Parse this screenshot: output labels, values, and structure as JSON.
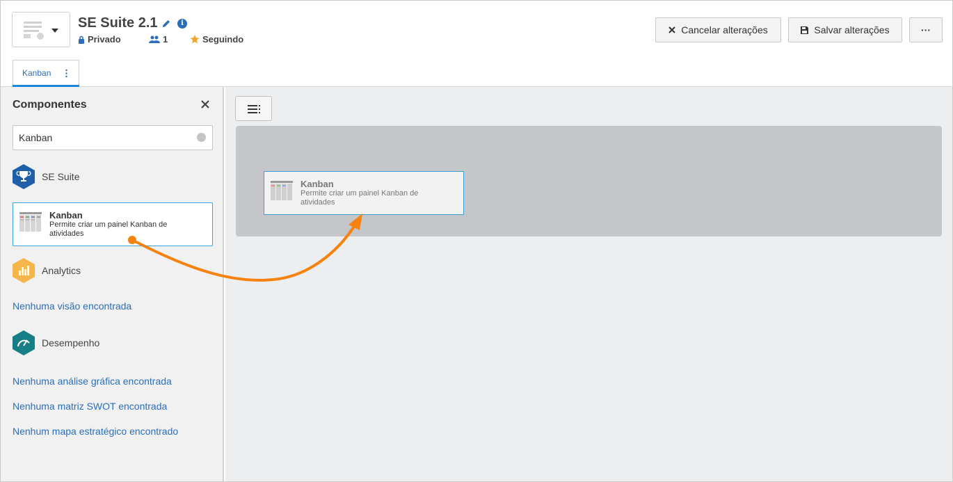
{
  "header": {
    "title": "SE Suite 2.1",
    "privacy": "Privado",
    "members": "1",
    "following": "Seguindo",
    "cancel_label": "Cancelar alterações",
    "save_label": "Salvar alterações",
    "more_label": "···"
  },
  "tabs": [
    {
      "label": "Kanban"
    }
  ],
  "sidebar": {
    "title": "Componentes",
    "search": {
      "value": "Kanban"
    },
    "groups": [
      {
        "label": "SE Suite",
        "icon": "trophy-icon",
        "color": "#1e5fa8"
      },
      {
        "label": "Analytics",
        "icon": "bar-chart-icon",
        "color": "#f5b54a"
      },
      {
        "label": "Desempenho",
        "icon": "gauge-icon",
        "color": "#167e86"
      }
    ],
    "component_card": {
      "title": "Kanban",
      "description": "Permite criar um painel Kanban de atividades"
    },
    "empty_messages": {
      "analytics": "Nenhuma visão encontrada",
      "graph": "Nenhuma análise gráfica encontrada",
      "swot": "Nenhuma matriz SWOT encontrada",
      "strategic": "Nenhum mapa estratégico encontrado"
    }
  },
  "canvas": {
    "placed_card": {
      "title": "Kanban",
      "description": "Permite criar um painel Kanban de atividades"
    }
  },
  "colors": {
    "accent": "#2a6ebb",
    "card_border": "#3aa0d8",
    "drag_arrow": "#f7820e",
    "drop_zone": "#c5c6ca"
  }
}
